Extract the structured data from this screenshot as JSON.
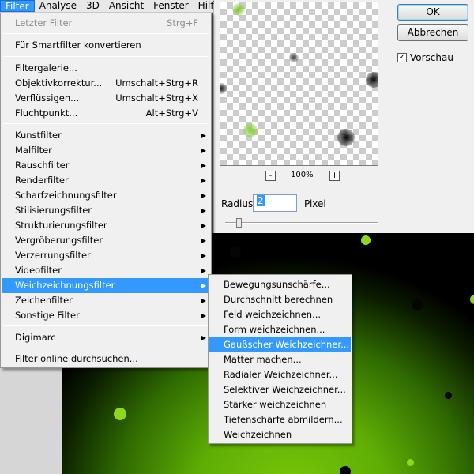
{
  "menubar": {
    "items": [
      "Filter",
      "Analyse",
      "3D",
      "Ansicht",
      "Fenster",
      "Hilf"
    ]
  },
  "filter_menu": {
    "items": [
      {
        "label": "Letzter Filter",
        "shortcut": "Strg+F"
      },
      {
        "label": "Für Smartfilter konvertieren",
        "shortcut": ""
      },
      {
        "label": "Filtergalerie...",
        "shortcut": ""
      },
      {
        "label": "Objektivkorrektur...",
        "shortcut": "Umschalt+Strg+R"
      },
      {
        "label": "Verflüssigen...",
        "shortcut": "Umschalt+Strg+X"
      },
      {
        "label": "Fluchtpunkt...",
        "shortcut": "Alt+Strg+V"
      },
      {
        "label": "Kunstfilter",
        "shortcut": ""
      },
      {
        "label": "Malfilter",
        "shortcut": ""
      },
      {
        "label": "Rauschfilter",
        "shortcut": ""
      },
      {
        "label": "Renderfilter",
        "shortcut": ""
      },
      {
        "label": "Scharfzeichnungsfilter",
        "shortcut": ""
      },
      {
        "label": "Stilisierungsfilter",
        "shortcut": ""
      },
      {
        "label": "Strukturierungsfilter",
        "shortcut": ""
      },
      {
        "label": "Vergröberungsfilter",
        "shortcut": ""
      },
      {
        "label": "Verzerrungsfilter",
        "shortcut": ""
      },
      {
        "label": "Videofilter",
        "shortcut": ""
      },
      {
        "label": "Weichzeichnungsfilter",
        "shortcut": ""
      },
      {
        "label": "Zeichenfilter",
        "shortcut": ""
      },
      {
        "label": "Sonstige Filter",
        "shortcut": ""
      },
      {
        "label": "Digimarc",
        "shortcut": ""
      },
      {
        "label": "Filter online durchsuchen...",
        "shortcut": ""
      }
    ]
  },
  "sub_menu": {
    "items": [
      "Bewegungsunschärfe...",
      "Durchschnitt berechnen",
      "Feld weichzeichnen...",
      "Form weichzeichnen...",
      "Gaußscher Weichzeichner...",
      "Matter machen...",
      "Radialer Weichzeichner...",
      "Selektiver Weichzeichner...",
      "Stärker weichzeichnen",
      "Tiefenschärfe abmildern...",
      "Weichzeichnen"
    ]
  },
  "dialog": {
    "ok_label": "OK",
    "cancel_label": "Abbrechen",
    "preview_label": "Vorschau",
    "preview_checked": true,
    "zoom_out": "-",
    "zoom_in": "+",
    "zoom_level": "100%",
    "radius_label": "Radius:",
    "radius_value": "2",
    "radius_unit": "Pixel"
  },
  "colors": {
    "highlight": "#3399ff",
    "canvas_green": "#7ac70a"
  }
}
